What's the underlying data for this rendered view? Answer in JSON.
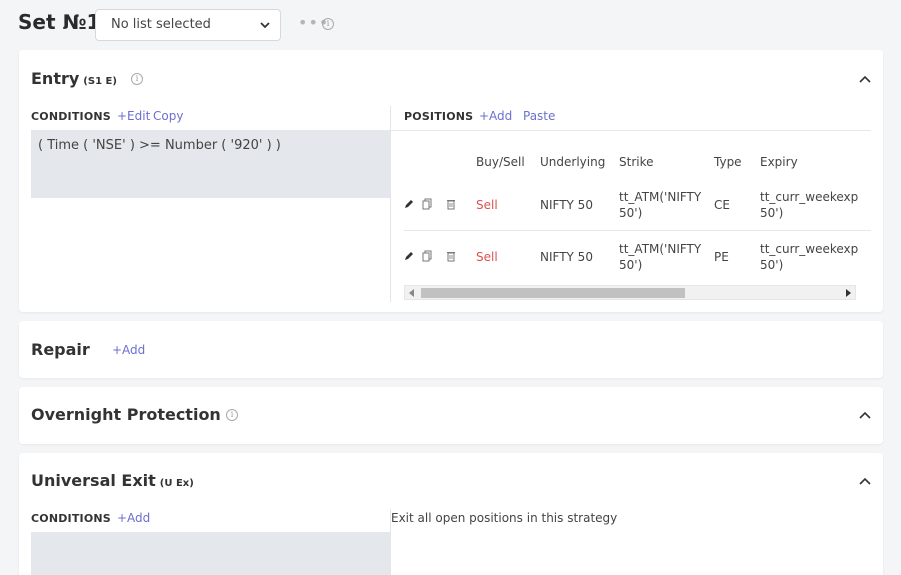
{
  "header": {
    "set_title": "Set №1",
    "list_select_value": "No list selected"
  },
  "entry": {
    "title": "Entry",
    "tag": "(S1 E)",
    "conditions_label": "CONDITIONS",
    "edit_link": "+Edit",
    "copy_link": "Copy",
    "condition_text": "( Time ( 'NSE' ) >= Number ( '920' ) )",
    "positions_label": "POSITIONS",
    "add_link": "+Add",
    "paste_link": "Paste",
    "columns": [
      "Buy/Sell",
      "Underlying",
      "Strike",
      "Type",
      "Expiry"
    ],
    "rows": [
      {
        "side": "Sell",
        "underlying": "NIFTY 50",
        "strike_l1": "tt_ATM('NIFTY",
        "strike_l2": "50')",
        "type": "CE",
        "expiry_l1": "tt_curr_weekexpi",
        "expiry_l2": "50')"
      },
      {
        "side": "Sell",
        "underlying": "NIFTY 50",
        "strike_l1": "tt_ATM('NIFTY",
        "strike_l2": "50')",
        "type": "PE",
        "expiry_l1": "tt_curr_weekexpi",
        "expiry_l2": "50')"
      }
    ]
  },
  "repair": {
    "title": "Repair",
    "add_link": "+Add"
  },
  "overnight": {
    "title": "Overnight Protection"
  },
  "universal_exit": {
    "title": "Universal Exit",
    "tag": "(U Ex)",
    "conditions_label": "CONDITIONS",
    "add_link": "+Add",
    "description": "Exit all open positions in this strategy"
  }
}
